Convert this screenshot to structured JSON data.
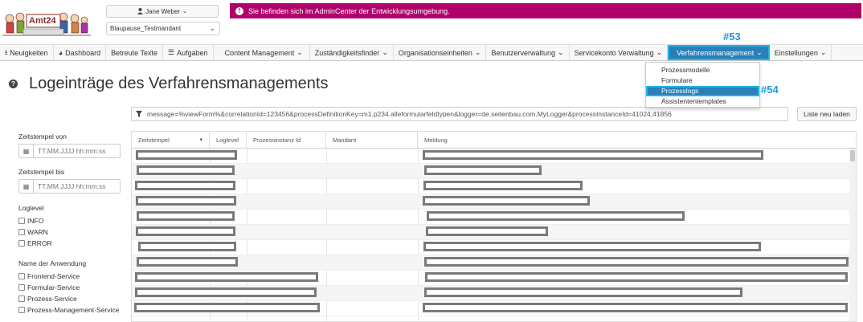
{
  "header": {
    "logo_text": "Amt24",
    "user_name": "Jane Weber",
    "tenant": "Blaupause_Testmandant",
    "env_banner": "Sie befinden sich im AdminCenter der Entwicklungsumgebung."
  },
  "nav": {
    "items": [
      {
        "label": "Neuigkeiten",
        "icon": "download-icon"
      },
      {
        "label": "Dashboard",
        "icon": "dashboard-icon"
      },
      {
        "label": "Betreute Texte"
      },
      {
        "label": "Aufgaben",
        "icon": "list-icon"
      },
      {
        "label": "Content Management",
        "dropdown": true
      },
      {
        "label": "Zuständigkeitsfinder",
        "dropdown": true
      },
      {
        "label": "Organisationseinheiten",
        "dropdown": true
      },
      {
        "label": "Benutzerverwaltung",
        "dropdown": true
      },
      {
        "label": "Servicekonto Verwaltung",
        "dropdown": true
      },
      {
        "label": "Verfahrensmanagement",
        "dropdown": true,
        "active": true
      },
      {
        "label": "Einstellungen",
        "dropdown": true
      }
    ],
    "active_marker": "#53"
  },
  "dropdown": {
    "items": [
      "Prozessmodelle",
      "Formulare",
      "Prozesslogs",
      "Assistententemplates"
    ],
    "active_index": 2,
    "active_marker": "#54"
  },
  "page": {
    "title": "Logeinträge des Verfahrensmanagements"
  },
  "filter": {
    "query": "message=%viewForm%&correlationId=123456&processDefinitionKey=m1.p234.alleformularfeldtypen&logger=de.seitenbau.com.MyLogger&processInstanceId=41024,41856",
    "reload_label": "Liste neu laden"
  },
  "sidebar": {
    "from_label": "Zeitstempel von",
    "to_label": "Zeitstempel bis",
    "date_placeholder": "TT.MM.JJJJ hh:mm:ss",
    "loglevel_label": "Loglevel",
    "loglevels": [
      "INFO",
      "WARN",
      "ERROR"
    ],
    "app_label": "Name der Anwendung",
    "apps": [
      "Frontend-Service",
      "Formular-Service",
      "Prozess-Service",
      "Prozess-Management-Service"
    ]
  },
  "table": {
    "columns": [
      "Zeitstempel",
      "Loglevel",
      "Prozessinstanz Id",
      "Mandant",
      "Meldung"
    ]
  }
}
